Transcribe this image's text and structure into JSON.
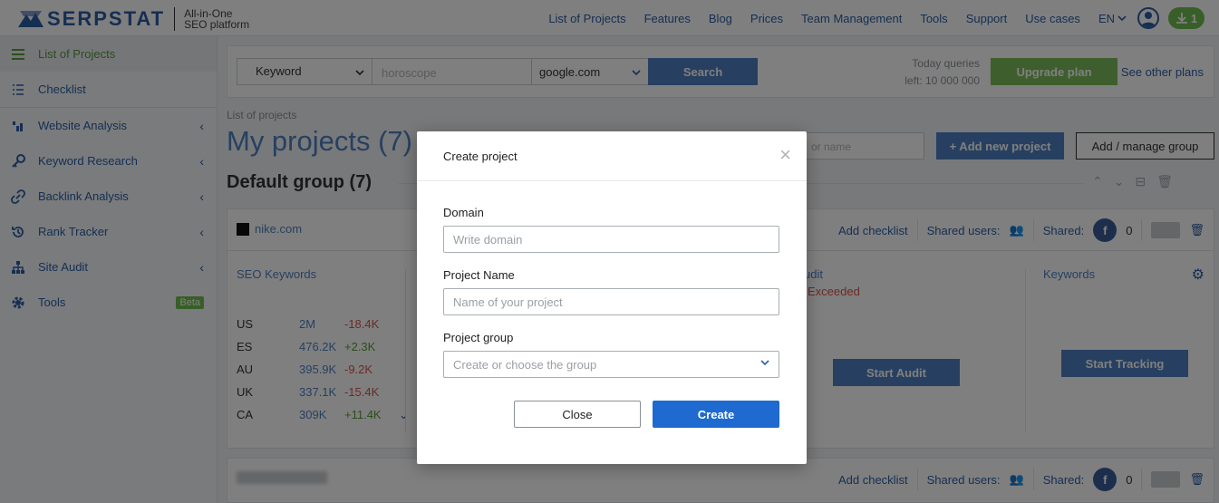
{
  "header": {
    "logo_text": "SERPSTAT",
    "tagline_1": "All-in-One",
    "tagline_2": "SEO platform",
    "nav": [
      "List of Projects",
      "Features",
      "Blog",
      "Prices",
      "Team Management",
      "Tools",
      "Support",
      "Use cases"
    ],
    "lang": "EN",
    "downloads_count": "1"
  },
  "sidebar": {
    "items": [
      {
        "label": "List of Projects",
        "icon": "hamburger-icon"
      },
      {
        "label": "Checklist",
        "icon": "checklist-icon"
      },
      {
        "label": "Website Analysis",
        "icon": "chart-icon"
      },
      {
        "label": "Keyword Research",
        "icon": "key-icon"
      },
      {
        "label": "Backlink Analysis",
        "icon": "link-icon"
      },
      {
        "label": "Rank Tracker",
        "icon": "history-icon"
      },
      {
        "label": "Site Audit",
        "icon": "sitemap-icon"
      },
      {
        "label": "Tools",
        "icon": "gear-icon"
      }
    ],
    "beta": "Beta"
  },
  "search": {
    "type": "Keyword",
    "placeholder": "horoscope",
    "engine": "google.com",
    "button": "Search",
    "queries_line1": "Today queries",
    "queries_line2": "left: 10 000 000",
    "upgrade": "Upgrade plan",
    "other_plans": "See other plans"
  },
  "main": {
    "breadcrumb": "List of projects",
    "title": "My projects (7)",
    "search_placeholder": "or name",
    "add_project": "+ Add new project",
    "manage_group": "Add / manage group",
    "group_title": "Default group (7)"
  },
  "card": {
    "domain": "nike.com",
    "add_checklist": "Add checklist",
    "shared_users": "Shared users:",
    "shared": "Shared:",
    "shared_count": "0",
    "seo_keywords": "SEO Keywords",
    "audit_title": "udit",
    "audit_status": "Exceeded",
    "keywords_title": "Keywords",
    "start_audit": "Start Audit",
    "start_tracking": "Start Tracking",
    "rows": [
      {
        "country": "US",
        "value": "2M",
        "delta": "-18.4K",
        "neg": true
      },
      {
        "country": "ES",
        "value": "476.2K",
        "delta": "+2.3K",
        "neg": false
      },
      {
        "country": "AU",
        "value": "395.9K",
        "delta": "-9.2K",
        "neg": true
      },
      {
        "country": "UK",
        "value": "337.1K",
        "delta": "-15.4K",
        "neg": true
      },
      {
        "country": "CA",
        "value": "309K",
        "delta": "+11.4K",
        "neg": false
      }
    ]
  },
  "modal": {
    "title": "Create project",
    "domain_label": "Domain",
    "domain_placeholder": "Write domain",
    "name_label": "Project Name",
    "name_placeholder": "Name of your project",
    "group_label": "Project group",
    "group_placeholder": "Create or choose the group",
    "close": "Close",
    "create": "Create"
  }
}
